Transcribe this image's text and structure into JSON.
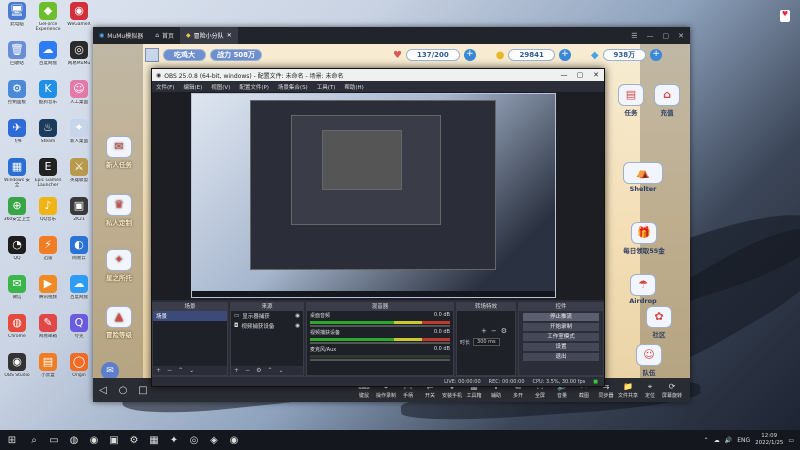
{
  "desktop": {
    "icons": [
      {
        "label": "此电脑",
        "glyph": "🖥",
        "color": "#4a7bd0"
      },
      {
        "label": "GeForce Experience",
        "glyph": "◆",
        "color": "#6cbe2d"
      },
      {
        "label": "WeGameX",
        "glyph": "◉",
        "color": "#d12f3a"
      },
      {
        "label": "回收站",
        "glyph": "🗑",
        "color": "#6b8fd6"
      },
      {
        "label": "百度网盘",
        "glyph": "☁",
        "color": "#2d7cf6"
      },
      {
        "label": "网易MuMu",
        "glyph": "◎",
        "color": "#2b2b2b"
      },
      {
        "label": "控制面板",
        "glyph": "⚙",
        "color": "#4a8ad8"
      },
      {
        "label": "酷狗音乐",
        "glyph": "K",
        "color": "#1f8fe8"
      },
      {
        "label": "人工桌面",
        "glyph": "☺",
        "color": "#e47aa9"
      },
      {
        "label": "飞书",
        "glyph": "✈",
        "color": "#2e6bd9"
      },
      {
        "label": "Steam",
        "glyph": "♨",
        "color": "#1b3a5c"
      },
      {
        "label": "新人桌面",
        "glyph": "✦",
        "color": "#c7d4ea"
      },
      {
        "label": "Windows 安全",
        "glyph": "▦",
        "color": "#2a6ed4"
      },
      {
        "label": "Epic Games Launcher",
        "glyph": "E",
        "color": "#222222"
      },
      {
        "label": "英雄联盟",
        "glyph": "⚔",
        "color": "#b79a4d"
      },
      {
        "label": "360安全卫士",
        "glyph": "⊕",
        "color": "#39a548"
      },
      {
        "label": "QQ音乐",
        "glyph": "♪",
        "color": "#f0b416"
      },
      {
        "label": "2K21",
        "glyph": "▣",
        "color": "#3a3a3a"
      },
      {
        "label": "QQ",
        "glyph": "◔",
        "color": "#1d1d1d"
      },
      {
        "label": "迅雷",
        "glyph": "⚡",
        "color": "#f07d23"
      },
      {
        "label": "网易云",
        "glyph": "◐",
        "color": "#2a74d6"
      },
      {
        "label": "微信",
        "glyph": "✉",
        "color": "#3bb64a"
      },
      {
        "label": "腾讯视频",
        "glyph": "▶",
        "color": "#f08a24"
      },
      {
        "label": "百度网盘",
        "glyph": "☁",
        "color": "#2d9cf6"
      },
      {
        "label": "Chrome",
        "glyph": "◍",
        "color": "#e54a3b"
      },
      {
        "label": "网易邮箱",
        "glyph": "✎",
        "color": "#e04848"
      },
      {
        "label": "夸克",
        "glyph": "Q",
        "color": "#6b5be0"
      },
      {
        "label": "OBS Studio",
        "glyph": "◉",
        "color": "#333333"
      },
      {
        "label": "小黑盒",
        "glyph": "▤",
        "color": "#f07d23"
      },
      {
        "label": "Origin",
        "glyph": "◯",
        "color": "#f06b23"
      }
    ]
  },
  "mumu": {
    "tabs": [
      {
        "label": "MuMu模拟器",
        "icon": "mumu-logo-icon"
      },
      {
        "label": "首页",
        "icon": "home-icon"
      },
      {
        "label": "冒险小分队",
        "icon": "game-icon"
      }
    ],
    "controls": [
      "☰",
      "—",
      "▢",
      "✕"
    ],
    "game": {
      "player_name": "吃鸡大",
      "power_label": "战力",
      "power_value": "508万",
      "stamina": "137/200",
      "coins": "29841",
      "gems": "938万",
      "left_buttons": [
        "新人任务",
        "私人定制",
        "星之所托",
        "冒险等级"
      ],
      "right_buttons": [
        "任务",
        "充值",
        "Shelter",
        "每日领取55金",
        "Airdrop",
        "社区",
        "队伍"
      ]
    },
    "toolbar": {
      "nav": [
        "◁",
        "○",
        "□"
      ],
      "tools": [
        {
          "label": "键鼠",
          "glyph": "⌨"
        },
        {
          "label": "操作录制",
          "glyph": "⏺"
        },
        {
          "label": "手柄",
          "glyph": "🎮"
        },
        {
          "label": "开关",
          "glyph": "⇄"
        },
        {
          "label": "安装手机",
          "glyph": "⬇"
        },
        {
          "label": "工具箱",
          "glyph": "▦"
        },
        {
          "label": "辅助",
          "glyph": "✚"
        },
        {
          "label": "多开",
          "glyph": "⧉"
        },
        {
          "label": "全屏",
          "glyph": "⛶"
        },
        {
          "label": "音量",
          "glyph": "🔊"
        },
        {
          "label": "截图",
          "glyph": "✂"
        },
        {
          "label": "同步器",
          "glyph": "⇆"
        },
        {
          "label": "文件共享",
          "glyph": "📁"
        },
        {
          "label": "定位",
          "glyph": "⌖"
        },
        {
          "label": "屏幕旋转",
          "glyph": "⟳"
        }
      ]
    }
  },
  "obs": {
    "title": "OBS 25.0.8 (64-bit, windows) - 配置文件: 未命名 - 场景: 未命名",
    "menu": [
      "文件(F)",
      "编辑(E)",
      "视图(V)",
      "配置文件(P)",
      "场景集合(S)",
      "工具(T)",
      "帮助(H)"
    ],
    "docks": {
      "scenes": {
        "title": "场景",
        "items": [
          "场景"
        ]
      },
      "sources": {
        "title": "来源",
        "items": [
          "显示器捕获",
          "视频捕获设备"
        ]
      },
      "mixer": {
        "title": "混音器",
        "channels": [
          {
            "name": "桌面音频",
            "db": "0.0 dB"
          },
          {
            "name": "视频捕获设备",
            "db": "0.0 dB"
          },
          {
            "name": "麦克风/Aux",
            "db": "0.0 dB"
          }
        ]
      },
      "transitions": {
        "title": "转场特效",
        "duration_label": "时长",
        "duration": "300 ms"
      },
      "controls": {
        "title": "控件",
        "buttons": [
          "停止推流",
          "开始录制",
          "工作室模式",
          "设置",
          "退出"
        ]
      }
    },
    "status": {
      "live": "LIVE: 00:00:00",
      "rec": "REC: 00:00:00",
      "cpu": "CPU: 3.5%, 30.00 fps"
    }
  },
  "taskbar": {
    "start": "⊞",
    "apps": [
      "⌕",
      "▭",
      "◍",
      "◉",
      "▣",
      "⚙",
      "▦",
      "✦",
      "◎",
      "◈",
      "◉"
    ],
    "tray": [
      "⌃",
      "☁",
      "🔊",
      "ENG"
    ],
    "time": "12:09",
    "date": "2022/1/25"
  }
}
